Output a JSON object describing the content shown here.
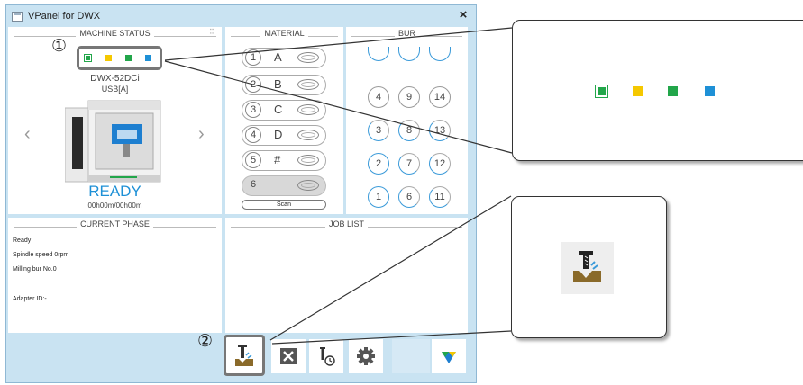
{
  "window": {
    "title": "VPanel for DWX",
    "close_glyph": "×"
  },
  "machine_status": {
    "heading": "MACHINE STATUS",
    "dot_colors": [
      "#22a64a",
      "#f5c800",
      "#22a64a",
      "#1e90d6"
    ],
    "model": "DWX-52DCi",
    "port": "USB[A]",
    "prev_glyph": "‹",
    "next_glyph": "›",
    "status": "READY",
    "timer": "00h00m/00h00m"
  },
  "material": {
    "heading": "MATERIAL",
    "slots": [
      {
        "num": "1",
        "label": "A"
      },
      {
        "num": "2",
        "label": "B"
      },
      {
        "num": "3",
        "label": "C"
      },
      {
        "num": "4",
        "label": "D"
      },
      {
        "num": "5",
        "label": "#"
      },
      {
        "num": "6",
        "label": ""
      }
    ],
    "scan_label": "Scan"
  },
  "bur": {
    "heading": "BUR",
    "row1": [
      "4",
      "9",
      "14"
    ],
    "row2": [
      "3",
      "8",
      "13"
    ],
    "row3": [
      "2",
      "7",
      "12"
    ],
    "row4": [
      "1",
      "6",
      "11"
    ]
  },
  "current_phase": {
    "heading": "CURRENT PHASE",
    "lines": [
      "Ready",
      "Spindle speed  0rpm",
      "Milling bur  No.0",
      "Adapter  ID:-"
    ]
  },
  "job_list": {
    "heading": "JOB LIST"
  },
  "callouts": {
    "marker1": "①",
    "marker2": "②"
  },
  "colors": {
    "accent": "#1e90d6",
    "titlebar": "#c9e3f2"
  },
  "icons": {
    "mill": "milling-icon",
    "cancel": "cancel-icon",
    "schedule": "mill-schedule-icon",
    "settings": "gear-icon",
    "logo": "roland-logo-icon"
  }
}
